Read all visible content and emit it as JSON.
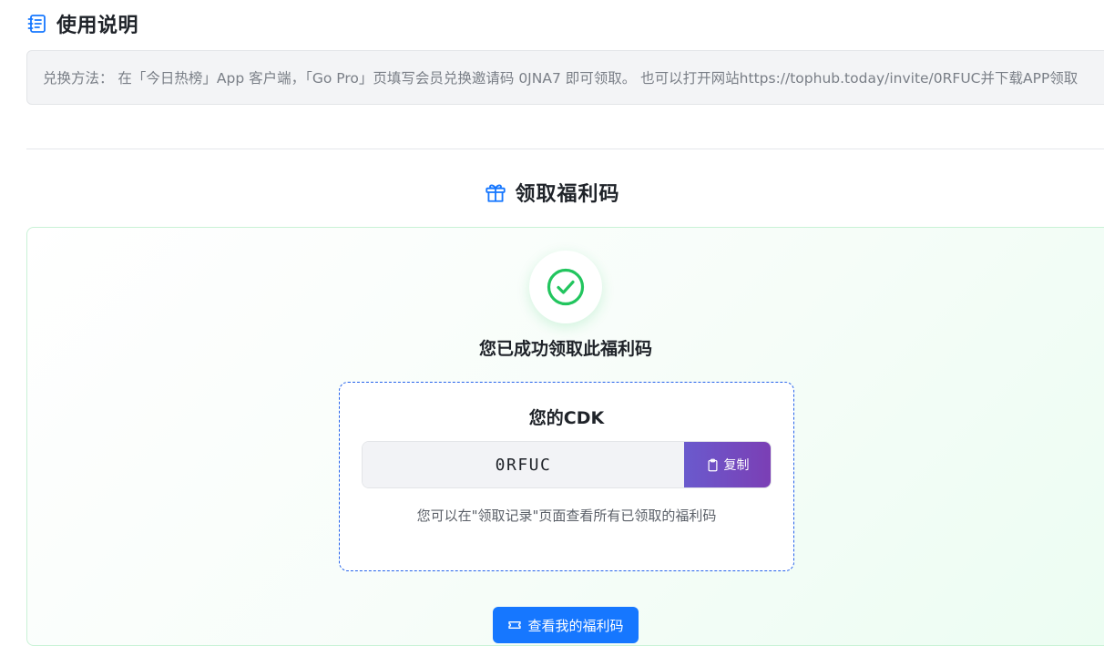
{
  "usage": {
    "title": "使用说明",
    "icon": "notebook-icon",
    "text": "兑换方法： 在「今日热榜」App 客户端，「Go Pro」页填写会员兑换邀请码 0JNA7 即可领取。 也可以打开网站https://tophub.today/invite/0RFUC并下载APP领取"
  },
  "claim": {
    "title": "领取福利码",
    "icon": "gift-icon",
    "success_icon": "check-circle-icon",
    "success_text": "您已成功领取此福利码",
    "cdk_title": "您的CDK",
    "cdk_value": "0RFUC",
    "copy_label": "复制",
    "copy_icon": "clipboard-icon",
    "hint": "您可以在\"领取记录\"页面查看所有已领取的福利码",
    "view_button_label": "查看我的福利码",
    "view_button_icon": "ticket-icon"
  },
  "colors": {
    "accent_blue": "#1677ff",
    "success_green": "#22c55e",
    "copy_gradient_start": "#6a5acd",
    "copy_gradient_end": "#7b3fb5"
  }
}
